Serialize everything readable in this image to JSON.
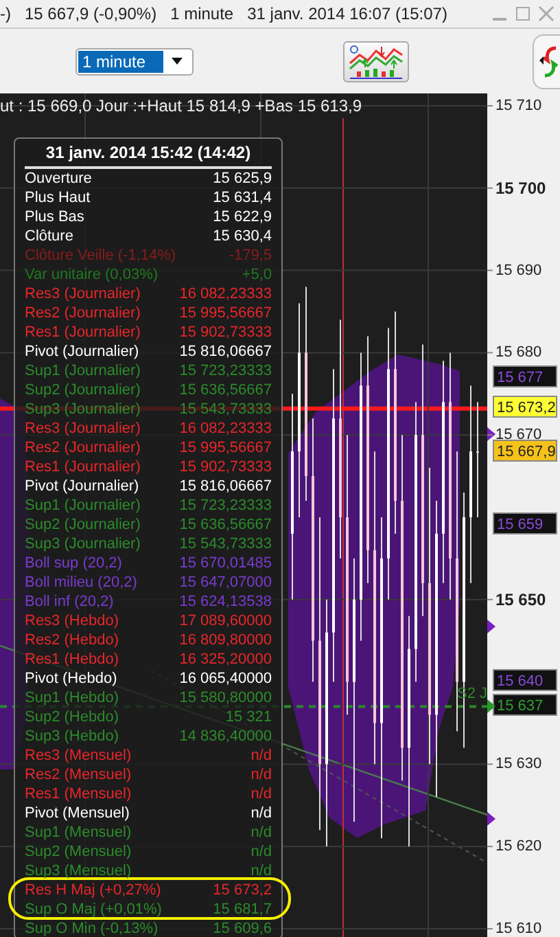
{
  "title_bar": {
    "texts": [
      "-)",
      "15 667,9 (-0,90%)",
      "1 minute",
      "31 janv. 2014 16:07 (15:07)"
    ]
  },
  "toolbar": {
    "interval_dropdown": {
      "value": "1 minute"
    }
  },
  "chart": {
    "header": "ut : 15 669,0 Jour :+Haut 15 814,9 +Bas 15 613,9",
    "price_tags": [
      {
        "label": "15 677",
        "kind": "band"
      },
      {
        "label": "15 673,2",
        "kind": "line"
      },
      {
        "label": "15 667,9",
        "kind": "current"
      },
      {
        "label": "15 659",
        "kind": "band"
      },
      {
        "label": "15 640",
        "kind": "band"
      },
      {
        "label": "15 637",
        "kind": "support"
      }
    ],
    "line_label": "S2 J",
    "chart_data": {
      "type": "candlestick",
      "ylim": [
        15609,
        15711.5
      ],
      "grid": true,
      "yticks": [
        {
          "value": 15710,
          "label": "15 710"
        },
        {
          "value": 15700,
          "label": "15 700"
        },
        {
          "value": 15690,
          "label": "15 690"
        },
        {
          "value": 15680,
          "label": "15 680"
        },
        {
          "value": 15670,
          "label": "15 670"
        },
        {
          "value": 15650,
          "label": "15 650"
        },
        {
          "value": 15630,
          "label": "15 630"
        },
        {
          "value": 15620,
          "label": "15 620"
        },
        {
          "value": 15610,
          "label": "15 610"
        }
      ],
      "ohlc": [
        [
          15658,
          15675,
          15650,
          15668
        ],
        [
          15668,
          15686,
          15660,
          15680
        ],
        [
          15680,
          15688,
          15662,
          15665
        ],
        [
          15665,
          15672,
          15640,
          15645
        ],
        [
          15645,
          15660,
          15622,
          15630
        ],
        [
          15630,
          15650,
          15620,
          15646
        ],
        [
          15646,
          15678,
          15640,
          15672
        ],
        [
          15672,
          15684,
          15655,
          15660
        ],
        [
          15660,
          15670,
          15636,
          15640
        ],
        [
          15640,
          15655,
          15623,
          15650
        ],
        [
          15650,
          15680,
          15645,
          15676
        ],
        [
          15676,
          15682,
          15652,
          15656
        ],
        [
          15656,
          15668,
          15630,
          15635
        ],
        [
          15635,
          15660,
          15621,
          15655
        ],
        [
          15655,
          15683,
          15650,
          15678
        ],
        [
          15678,
          15685,
          15658,
          15662
        ],
        [
          15662,
          15670,
          15628,
          15632
        ],
        [
          15632,
          15648,
          15620,
          15644
        ],
        [
          15644,
          15674,
          15640,
          15670
        ],
        [
          15670,
          15681,
          15648,
          15652
        ],
        [
          15652,
          15666,
          15630,
          15636
        ],
        [
          15636,
          15662,
          15626,
          15658
        ],
        [
          15658,
          15679,
          15652,
          15674
        ],
        [
          15674,
          15680,
          15650,
          15655
        ],
        [
          15655,
          15668,
          15634,
          15640
        ],
        [
          15640,
          15663,
          15632,
          15660
        ],
        [
          15660,
          15676,
          15652,
          15668
        ],
        [
          15668,
          15674,
          15660,
          15667.9
        ]
      ]
    }
  },
  "tooltip": {
    "title": "31 janv. 2014 15:42 (14:42)",
    "rows": [
      {
        "label": "Ouverture",
        "value": "15 625,9",
        "color": "#ffffff"
      },
      {
        "label": "Plus Haut",
        "value": "15 631,4",
        "color": "#ffffff"
      },
      {
        "label": "Plus Bas",
        "value": "15 622,9",
        "color": "#ffffff"
      },
      {
        "label": "Clôture",
        "value": "15 630,4",
        "color": "#ffffff"
      },
      {
        "label": "Clôture Veille (-1,14%)",
        "value": "-179,5",
        "color": "#8a1c1c"
      },
      {
        "label": "Var unitaire (0,03%)",
        "value": "+5,0",
        "color": "#1f7a1f"
      },
      {
        "label": "Res3 (Journalier)",
        "value": "16 082,23333",
        "color": "#e8262a"
      },
      {
        "label": "Res2 (Journalier)",
        "value": "15 995,56667",
        "color": "#e8262a"
      },
      {
        "label": "Res1 (Journalier)",
        "value": "15 902,73333",
        "color": "#e8262a"
      },
      {
        "label": "Pivot (Journalier)",
        "value": "15 816,06667",
        "color": "#ffffff"
      },
      {
        "label": "Sup1 (Journalier)",
        "value": "15 723,23333",
        "color": "#2b8c2b"
      },
      {
        "label": "Sup2 (Journalier)",
        "value": "15 636,56667",
        "color": "#2b8c2b"
      },
      {
        "label": "Sup3 (Journalier)",
        "value": "15 543,73333",
        "color": "#2b8c2b"
      },
      {
        "label": "Res3 (Journalier)",
        "value": "16 082,23333",
        "color": "#e8262a"
      },
      {
        "label": "Res2 (Journalier)",
        "value": "15 995,56667",
        "color": "#e8262a"
      },
      {
        "label": "Res1 (Journalier)",
        "value": "15 902,73333",
        "color": "#e8262a"
      },
      {
        "label": "Pivot (Journalier)",
        "value": "15 816,06667",
        "color": "#ffffff"
      },
      {
        "label": "Sup1 (Journalier)",
        "value": "15 723,23333",
        "color": "#2b8c2b"
      },
      {
        "label": "Sup2 (Journalier)",
        "value": "15 636,56667",
        "color": "#2b8c2b"
      },
      {
        "label": "Sup3 (Journalier)",
        "value": "15 543,73333",
        "color": "#2b8c2b"
      },
      {
        "label": "Boll sup (20,2)",
        "value": "15 670,01485",
        "color": "#7a3ad0"
      },
      {
        "label": "Boll milieu (20,2)",
        "value": "15 647,07000",
        "color": "#7a3ad0"
      },
      {
        "label": "Boll inf (20,2)",
        "value": "15 624,13538",
        "color": "#7a3ad0"
      },
      {
        "label": "Res3 (Hebdo)",
        "value": "17 089,60000",
        "color": "#e8262a"
      },
      {
        "label": "Res2 (Hebdo)",
        "value": "16 809,80000",
        "color": "#e8262a"
      },
      {
        "label": "Res1 (Hebdo)",
        "value": "16 325,20000",
        "color": "#e8262a"
      },
      {
        "label": "Pivot (Hebdo)",
        "value": "16 065,40000",
        "color": "#ffffff"
      },
      {
        "label": "Sup1 (Hebdo)",
        "value": "15 580,80000",
        "color": "#2b8c2b"
      },
      {
        "label": "Sup2 (Hebdo)",
        "value": "15 321",
        "color": "#2b8c2b"
      },
      {
        "label": "Sup3 (Hebdo)",
        "value": "14 836,40000",
        "color": "#2b8c2b"
      },
      {
        "label": "Res3 (Mensuel)",
        "value": "n/d",
        "color": "#e8262a"
      },
      {
        "label": "Res2 (Mensuel)",
        "value": "n/d",
        "color": "#e8262a"
      },
      {
        "label": "Res1 (Mensuel)",
        "value": "n/d",
        "color": "#e8262a"
      },
      {
        "label": "Pivot (Mensuel)",
        "value": "n/d",
        "color": "#ffffff"
      },
      {
        "label": "Sup1 (Mensuel)",
        "value": "n/d",
        "color": "#2b8c2b"
      },
      {
        "label": "Sup2 (Mensuel)",
        "value": "n/d",
        "color": "#2b8c2b"
      },
      {
        "label": "Sup3 (Mensuel)",
        "value": "n/d",
        "color": "#2b8c2b"
      },
      {
        "label": "Res H Maj (+0,27%)",
        "value": "15 673,2",
        "color": "#e8262a"
      },
      {
        "label": "Sup O Maj (+0,01%)",
        "value": "15 681,7",
        "color": "#2b8c2b"
      },
      {
        "label": "Sup O Min (-0,13%)",
        "value": "15 609,6",
        "color": "#2b8c2b"
      }
    ]
  }
}
